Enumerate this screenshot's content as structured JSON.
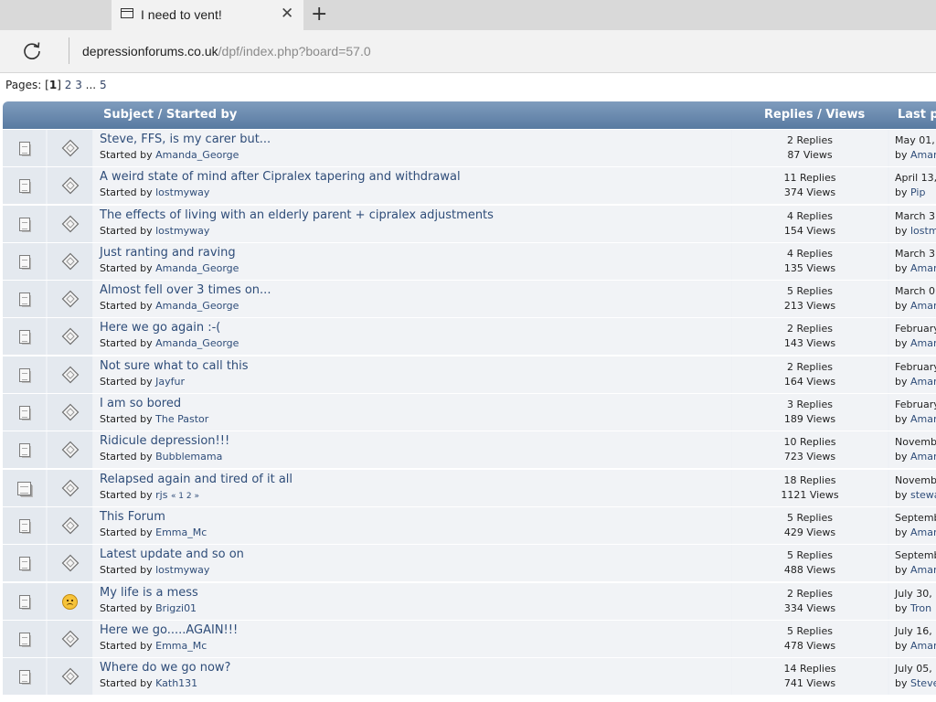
{
  "browser": {
    "tab_title": "I need to vent!",
    "tab_close": "✕",
    "new_tab": "+",
    "url_host": "depressionforums.co.uk",
    "url_path": "/dpf/index.php?board=57.0"
  },
  "pagination": {
    "label": "Pages:",
    "current": "1",
    "pages": [
      "2",
      "3"
    ],
    "ellipsis": "...",
    "last": "5"
  },
  "table": {
    "header_subject": "Subject / Started by",
    "header_stats": "Replies / Views",
    "header_last": "Last p",
    "started_by_label": "Started by",
    "by_label": "by",
    "rows": [
      {
        "icon": "doc-icon",
        "post_icon": "post-icon",
        "title": "Steve, FFS, is my carer but...",
        "author": "Amanda_George",
        "replies": "2 Replies",
        "views": "87 Views",
        "last_date": "May 01,",
        "last_by": "Amar"
      },
      {
        "icon": "doc-icon",
        "post_icon": "post-icon",
        "title": "A weird state of mind after Cipralex tapering and withdrawal",
        "author": "lostmyway",
        "replies": "11 Replies",
        "views": "374 Views",
        "last_date": "April 13,",
        "last_by": "Pip"
      },
      {
        "icon": "doc-icon",
        "post_icon": "post-icon",
        "title": "The effects of living with an elderly parent + cipralex adjustments",
        "author": "lostmyway",
        "replies": "4 Replies",
        "views": "154 Views",
        "last_date": "March 3",
        "last_by": "lostm"
      },
      {
        "icon": "doc-icon",
        "post_icon": "post-icon",
        "title": "Just ranting and raving",
        "author": "Amanda_George",
        "replies": "4 Replies",
        "views": "135 Views",
        "last_date": "March 3",
        "last_by": "Amar"
      },
      {
        "icon": "doc-icon",
        "post_icon": "post-icon",
        "title": "Almost fell over 3 times on...",
        "author": "Amanda_George",
        "replies": "5 Replies",
        "views": "213 Views",
        "last_date": "March 0",
        "last_by": "Amar"
      },
      {
        "icon": "doc-icon",
        "post_icon": "post-icon",
        "title": "Here we go again :-(",
        "author": "Amanda_George",
        "replies": "2 Replies",
        "views": "143 Views",
        "last_date": "February",
        "last_by": "Amar"
      },
      {
        "icon": "doc-icon",
        "post_icon": "post-icon",
        "title": "Not sure what to call this",
        "author": "Jayfur",
        "replies": "2 Replies",
        "views": "164 Views",
        "last_date": "February",
        "last_by": "Amar"
      },
      {
        "icon": "doc-icon",
        "post_icon": "post-icon",
        "title": "I am so bored",
        "author": "The Pastor",
        "replies": "3 Replies",
        "views": "189 Views",
        "last_date": "February",
        "last_by": "Amar"
      },
      {
        "icon": "doc-icon",
        "post_icon": "post-icon",
        "title": "Ridicule depression!!!",
        "author": "Bubblemama",
        "replies": "10 Replies",
        "views": "723 Views",
        "last_date": "Novemb",
        "last_by": "Amar"
      },
      {
        "icon": "hot-icon",
        "post_icon": "post-icon",
        "title": "Relapsed again and tired of it all",
        "author": "rjs",
        "mini_pages": "« 1 2 »",
        "replies": "18 Replies",
        "views": "1121 Views",
        "last_date": "Novemb",
        "last_by": "stewa"
      },
      {
        "icon": "doc-icon",
        "post_icon": "post-icon",
        "title": "This Forum",
        "author": "Emma_Mc",
        "replies": "5 Replies",
        "views": "429 Views",
        "last_date": "Septemb",
        "last_by": "Amar"
      },
      {
        "icon": "doc-icon",
        "post_icon": "post-icon",
        "title": "Latest update and so on",
        "author": "lostmyway",
        "replies": "5 Replies",
        "views": "488 Views",
        "last_date": "Septemb",
        "last_by": "Amar"
      },
      {
        "icon": "doc-icon",
        "post_icon": "frown-icon",
        "title": "My life is a mess",
        "author": "Brigzi01",
        "replies": "2 Replies",
        "views": "334 Views",
        "last_date": "July 30,",
        "last_by": "Tron"
      },
      {
        "icon": "doc-icon",
        "post_icon": "post-icon",
        "title": "Here we go.....AGAIN!!!",
        "author": "Emma_Mc",
        "replies": "5 Replies",
        "views": "478 Views",
        "last_date": "July 16,",
        "last_by": "Amar"
      },
      {
        "icon": "doc-icon",
        "post_icon": "post-icon",
        "title": "Where do we go now?",
        "author": "Kath131",
        "replies": "14 Replies",
        "views": "741 Views",
        "last_date": "July 05,",
        "last_by": "Steve"
      }
    ]
  }
}
